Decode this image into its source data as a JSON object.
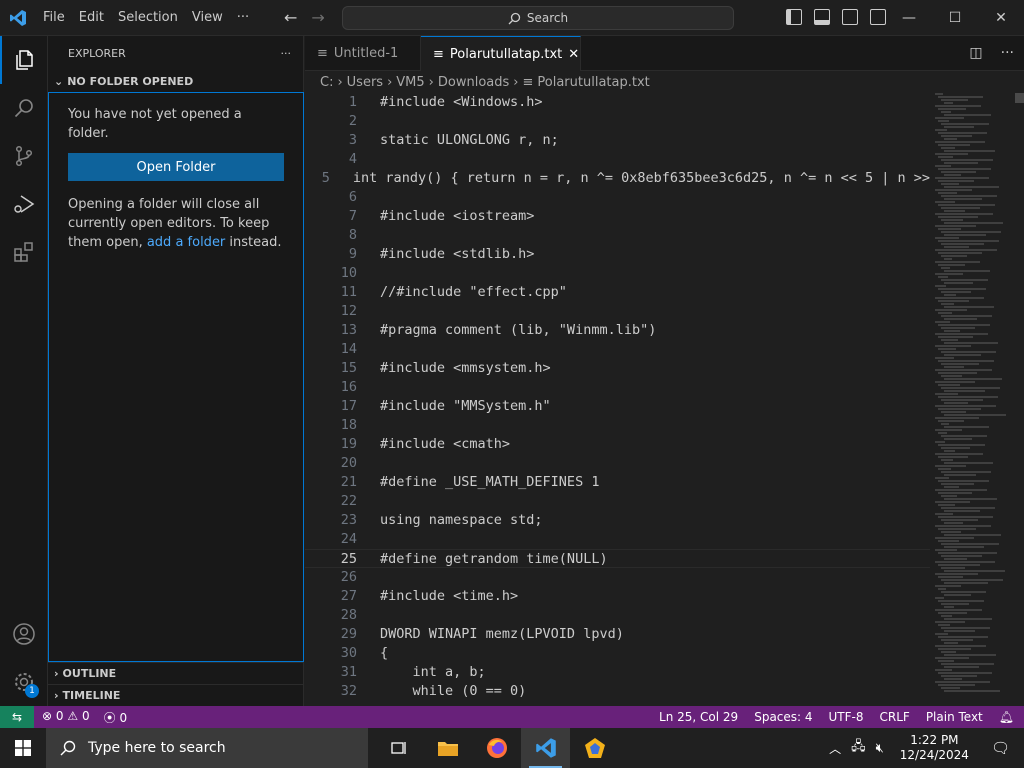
{
  "menu": [
    "File",
    "Edit",
    "Selection",
    "View",
    "···"
  ],
  "search": {
    "label": "Search"
  },
  "explorer": {
    "title": "EXPLORER",
    "section": "NO FOLDER OPENED",
    "msg1": "You have not yet opened a folder.",
    "open_button": "Open Folder",
    "msg2_a": "Opening a folder will close all currently open editors. To keep them open, ",
    "msg2_link": "add a folder",
    "msg2_b": " instead.",
    "outline": "OUTLINE",
    "timeline": "TIMELINE",
    "accounts_badge": "1"
  },
  "tabs": [
    {
      "label": "Untitled-1"
    },
    {
      "label": "Polarutullatap.txt"
    }
  ],
  "breadcrumb": [
    "C:",
    "Users",
    "VM5",
    "Downloads",
    "Polarutullatap.txt"
  ],
  "code": [
    {
      "n": "1",
      "t": "#include <Windows.h>"
    },
    {
      "n": "2",
      "t": ""
    },
    {
      "n": "3",
      "t": "static ULONGLONG r, n;"
    },
    {
      "n": "4",
      "t": ""
    },
    {
      "n": "5",
      "t": "int randy() { return n = r, n ^= 0x8ebf635bee3c6d25, n ^= n << 5 | n >>"
    },
    {
      "n": "6",
      "t": ""
    },
    {
      "n": "7",
      "t": "#include <iostream>"
    },
    {
      "n": "8",
      "t": ""
    },
    {
      "n": "9",
      "t": "#include <stdlib.h>"
    },
    {
      "n": "10",
      "t": ""
    },
    {
      "n": "11",
      "t": "//#include \"effect.cpp\""
    },
    {
      "n": "12",
      "t": ""
    },
    {
      "n": "13",
      "t": "#pragma comment (lib, \"Winmm.lib\")"
    },
    {
      "n": "14",
      "t": ""
    },
    {
      "n": "15",
      "t": "#include <mmsystem.h>"
    },
    {
      "n": "16",
      "t": ""
    },
    {
      "n": "17",
      "t": "#include \"MMSystem.h\""
    },
    {
      "n": "18",
      "t": ""
    },
    {
      "n": "19",
      "t": "#include <cmath>"
    },
    {
      "n": "20",
      "t": ""
    },
    {
      "n": "21",
      "t": "#define _USE_MATH_DEFINES 1"
    },
    {
      "n": "22",
      "t": ""
    },
    {
      "n": "23",
      "t": "using namespace std;"
    },
    {
      "n": "24",
      "t": ""
    },
    {
      "n": "25",
      "t": "#define getrandom time(NULL)"
    },
    {
      "n": "26",
      "t": ""
    },
    {
      "n": "27",
      "t": "#include <time.h>"
    },
    {
      "n": "28",
      "t": ""
    },
    {
      "n": "29",
      "t": "DWORD WINAPI memz(LPVOID lpvd)"
    },
    {
      "n": "30",
      "t": "{"
    },
    {
      "n": "31",
      "t": "    int a, b;"
    },
    {
      "n": "32",
      "t": "    while (0 == 0)"
    }
  ],
  "current_line": 25,
  "status": {
    "errors": "0",
    "warnings": "0",
    "ports": "0",
    "position": "Ln 25, Col 29",
    "spaces": "Spaces: 4",
    "encoding": "UTF-8",
    "eol": "CRLF",
    "language": "Plain Text"
  },
  "taskbar": {
    "search_placeholder": "Type here to search",
    "time": "1:22 PM",
    "date": "12/24/2024"
  },
  "colors": {
    "accent": "#0078d4",
    "statusbar": "#68217a",
    "remote": "#16825d",
    "button": "#0e639c"
  }
}
